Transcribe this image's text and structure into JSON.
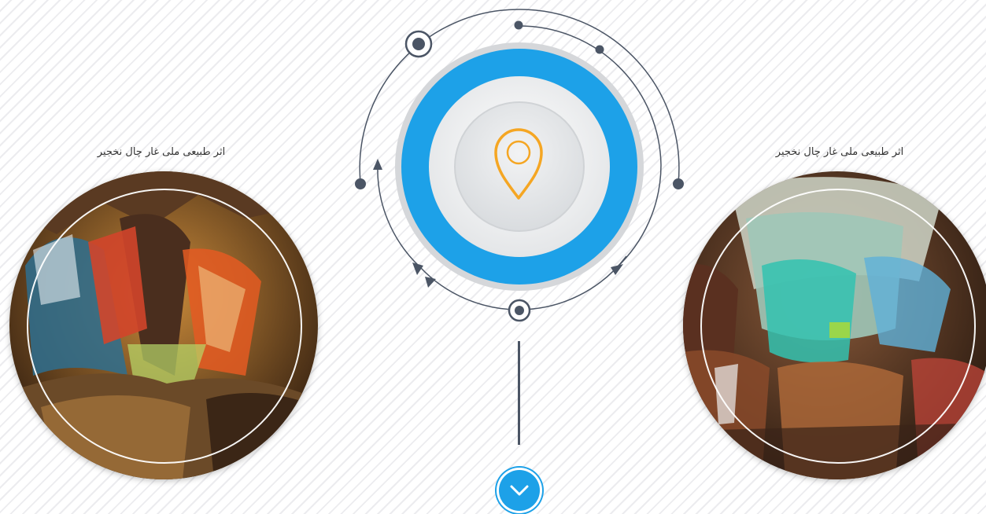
{
  "left_card": {
    "caption": "اثر طبیعی ملی غار چال نخجیر"
  },
  "right_card": {
    "caption": "اثر طبیعی ملی غار چال نخجیر"
  },
  "center": {
    "icon": "location-pin-icon"
  },
  "scroll_button": {
    "icon": "chevron-down-icon"
  },
  "colors": {
    "accent_blue": "#1da1e8",
    "pin_orange": "#f5a623",
    "line_dark": "#4b5565"
  }
}
